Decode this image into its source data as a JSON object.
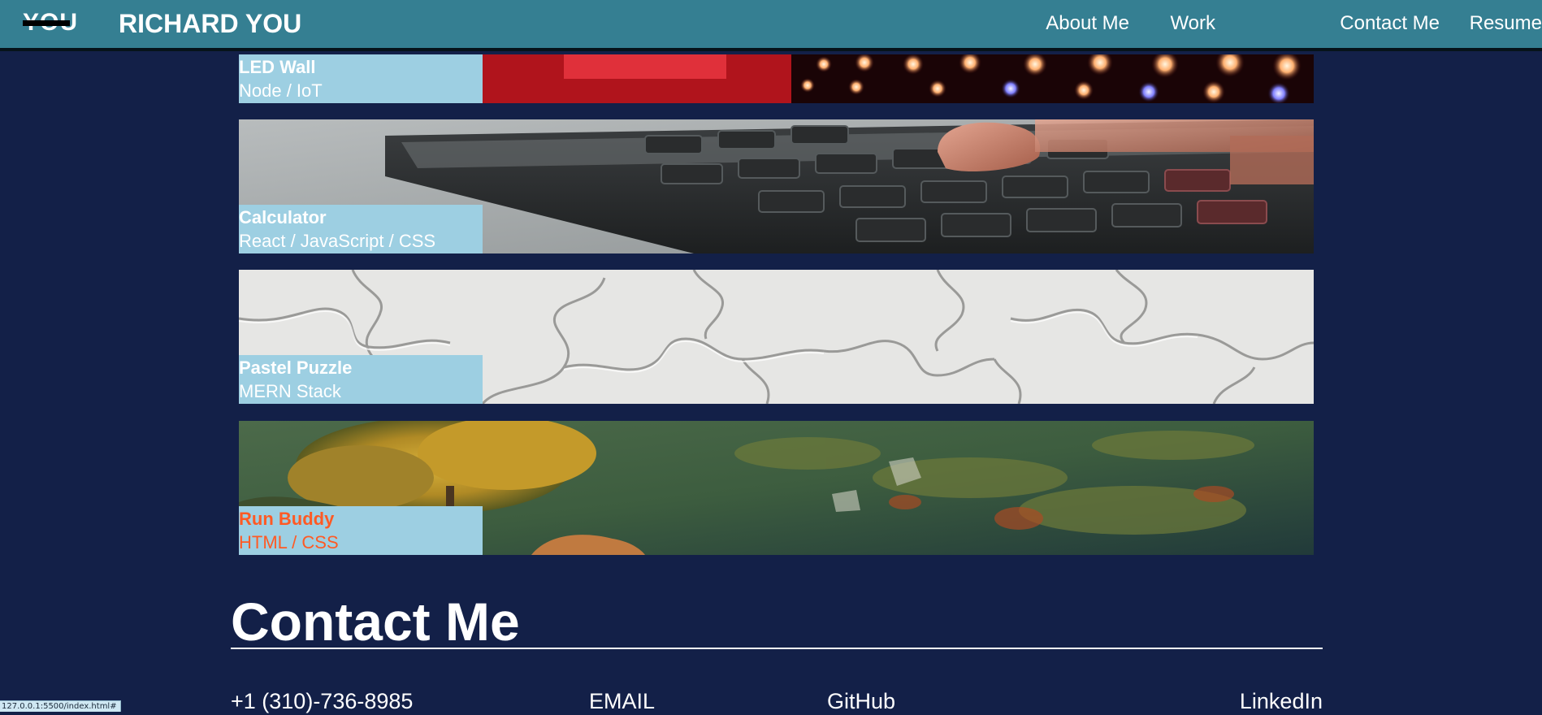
{
  "header": {
    "logo_text": "YOU",
    "brand": "RICHARD YOU",
    "nav": [
      "About Me",
      "Work",
      "Contact Me",
      "Resume"
    ]
  },
  "projects": [
    {
      "title": "LED Wall",
      "tech": "Node / IoT",
      "image": "led-wall-image"
    },
    {
      "title": "Calculator",
      "tech": "React / JavaScript / CSS",
      "image": "calculator-image"
    },
    {
      "title": "Pastel Puzzle",
      "tech": "MERN Stack",
      "image": "puzzle-image"
    },
    {
      "title": "Run Buddy",
      "tech": "HTML / CSS",
      "image": "landscape-image"
    }
  ],
  "contact": {
    "heading": "Contact Me",
    "links": [
      "+1 (310)-736-8985",
      "EMAIL",
      "GitHub",
      "LinkedIn"
    ]
  },
  "status_url": "127.0.0.1:5500/index.html#",
  "colors": {
    "background": "#132048",
    "header": "#357f92",
    "caption_bg": "#9dcfe2",
    "accent_orange": "#ff5a24"
  }
}
